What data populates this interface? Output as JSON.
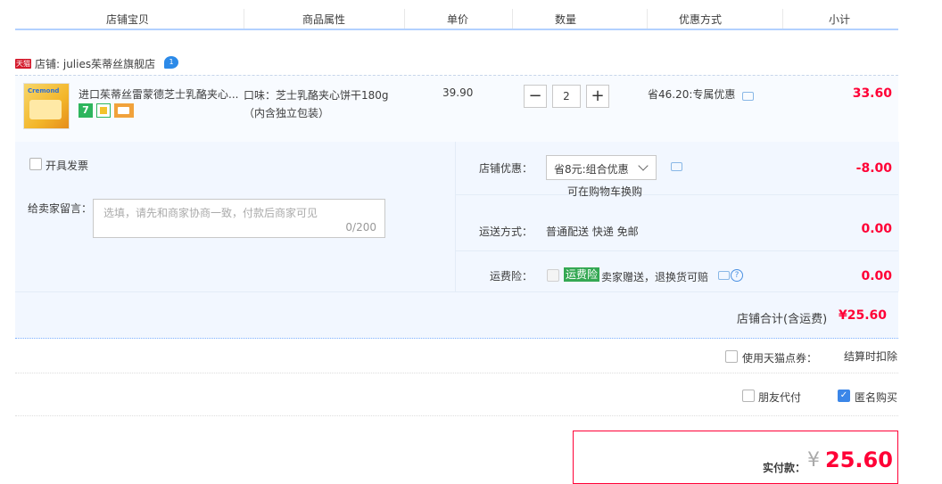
{
  "header": {
    "col_shop_item": "店铺宝贝",
    "col_attributes": "商品属性",
    "col_unit_price": "单价",
    "col_quantity": "数量",
    "col_discount": "优惠方式",
    "col_subtotal": "小计"
  },
  "shop": {
    "tmall_badge": "天猫",
    "name": "店铺: julies茱蒂丝旗舰店",
    "chat_badge": "1"
  },
  "item": {
    "thumb_text": "Cremond",
    "name": "进口茱蒂丝雷蒙德芝士乳酪夹心...",
    "service_badge_7": "7",
    "attr_line1": "口味：芝士乳酪夹心饼干180g",
    "attr_line2": "（内含独立包装）",
    "unit_price": "39.90",
    "qty_minus": "−",
    "quantity": "2",
    "qty_plus": "+",
    "discount": "省46.20:专属优惠",
    "subtotal": "33.60"
  },
  "options": {
    "invoice_label": "开具发票",
    "message_label": "给卖家留言：",
    "message_placeholder": "选填，请先和商家协商一致，付款后商家可见",
    "message_count": "0/200",
    "shop_discount_label": "店铺优惠：",
    "shop_discount_value": "省8元:组合优惠",
    "shop_discount_hint": "可在购物车换购",
    "shop_discount_amount": "-8.00",
    "shipping_label": "运送方式：",
    "shipping_value": "普通配送 快递 免邮",
    "shipping_amount": "0.00",
    "insurance_label": "运费险：",
    "insurance_badge": "运费险",
    "insurance_desc": "卖家赠送，退换货可赔",
    "insurance_amount": "0.00",
    "shop_total_label": "店铺合计(含运费)",
    "shop_total_value": "¥25.60"
  },
  "footer": {
    "coupon_label": "使用天猫点券：",
    "coupon_note": "结算时扣除",
    "friend_pay_label": "朋友代付",
    "anonymous_label": "匿名购买",
    "anonymous_checked": true,
    "actual_label": "实付款：",
    "currency": "¥",
    "actual_amount": "25.60"
  },
  "colors": {
    "accent_red": "#ff0036",
    "header_border": "#b2d1ff",
    "panel_bg": "#f2f7ff"
  }
}
